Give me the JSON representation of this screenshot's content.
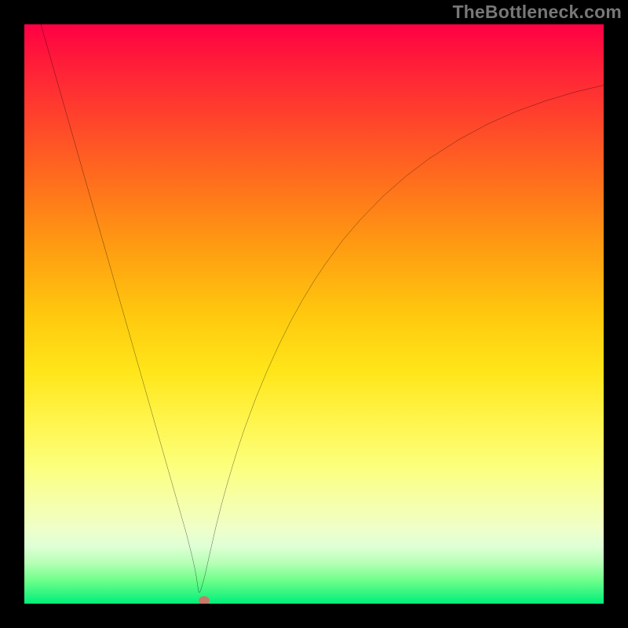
{
  "watermark": "TheBottleneck.com",
  "colors": {
    "background": "#000000",
    "curve": "#000000",
    "marker": "#c77a6a"
  },
  "chart_data": {
    "type": "line",
    "title": "",
    "xlabel": "",
    "ylabel": "",
    "xlim": [
      0,
      100
    ],
    "ylim": [
      0,
      100
    ],
    "grid": false,
    "legend": false,
    "marker": {
      "x": 31,
      "y": 0.5
    },
    "series": [
      {
        "name": "bottleneck-curve",
        "x": [
          0,
          2,
          4,
          6,
          8,
          10,
          12,
          14,
          16,
          18,
          20,
          22,
          24,
          25,
          26,
          27,
          28,
          28.5,
          29,
          29.4,
          29.7,
          29.9,
          30.1,
          30.3,
          30.5,
          30.8,
          31.2,
          31.6,
          32,
          32.5,
          33,
          34,
          35,
          36,
          37,
          38,
          40,
          42,
          44,
          46,
          48,
          50,
          52,
          55,
          58,
          62,
          66,
          70,
          75,
          80,
          85,
          90,
          95,
          100
        ],
        "y": [
          110,
          103,
          96,
          89,
          82,
          75,
          68,
          61,
          54,
          47,
          40,
          33,
          26,
          22.5,
          19,
          15.5,
          12,
          10,
          8,
          6.2,
          4.6,
          3.2,
          2,
          2,
          2.5,
          3.5,
          5,
          6.8,
          8.6,
          10.8,
          13,
          17,
          20.6,
          24,
          27.2,
          30.2,
          35.6,
          40.4,
          44.8,
          48.8,
          52.4,
          55.7,
          58.7,
          62.8,
          66.3,
          70.4,
          73.9,
          76.9,
          80.1,
          82.8,
          85,
          86.8,
          88.3,
          89.5
        ]
      }
    ]
  }
}
